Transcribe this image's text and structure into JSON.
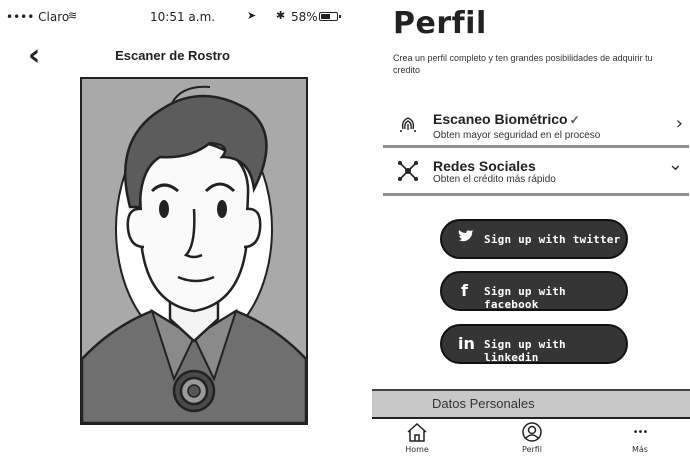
{
  "left": {
    "status": {
      "carrier": "•••• Claro",
      "time": "10:51 a.m.",
      "battery": "58%",
      "battery_level": 0.58
    },
    "nav": {
      "back_icon": "chevron-left-icon",
      "title": "Escaner de Rostro"
    }
  },
  "right": {
    "title": "Perfil",
    "subtitle": "Crea un perfil completo y ten grandes posibilidades de adquirir tu credito",
    "rows": [
      {
        "label": "Escaneo Biométrico",
        "check": "✓",
        "desc": "Obten mayor seguridad en el proceso",
        "icon": "fingerprint-icon",
        "chevron": "›"
      },
      {
        "label": "Redes Sociales",
        "desc": "Obten el crédito más rápido",
        "icon": "network-icon",
        "chevron": "⌄"
      }
    ],
    "social": [
      {
        "label": "Sign up with twitter",
        "icon": "twitter-icon",
        "glyph": "🐦"
      },
      {
        "label": "Sign up with facebook",
        "icon": "facebook-icon",
        "glyph": "f"
      },
      {
        "label": "Sign up with linkedin",
        "icon": "linkedin-icon",
        "glyph": "in"
      }
    ],
    "datos_label": "Datos Personales",
    "tabs": [
      {
        "label": "Home",
        "icon": "home-icon"
      },
      {
        "label": "Perfil",
        "icon": "profile-icon"
      },
      {
        "label": "Más",
        "icon": "more-icon",
        "glyph": "•••"
      }
    ]
  },
  "colors": {
    "button_bg": "#353535",
    "photo_bg": "#a9a9a9",
    "divider": "#8f8f8f",
    "datos_bg": "#c8c8c8"
  }
}
